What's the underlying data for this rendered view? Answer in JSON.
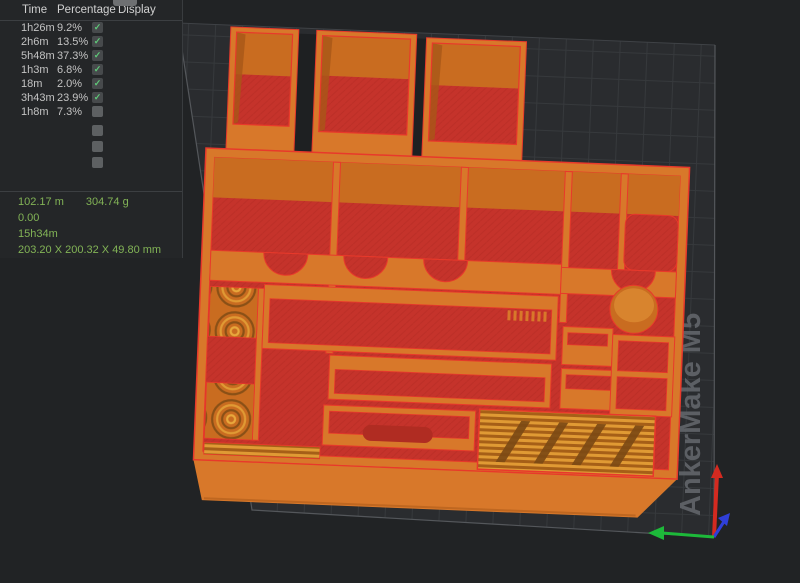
{
  "legend": {
    "headers": {
      "time": "Time",
      "percentage": "Percentage",
      "display": "Display"
    },
    "check_glyph": "✓",
    "rows": [
      {
        "time": "1h26m",
        "percentage": "9.2%",
        "checked": true
      },
      {
        "time": "2h6m",
        "percentage": "13.5%",
        "checked": true
      },
      {
        "time": "5h48m",
        "percentage": "37.3%",
        "checked": true
      },
      {
        "time": "1h3m",
        "percentage": "6.8%",
        "checked": true
      },
      {
        "time": "18m",
        "percentage": "2.0%",
        "checked": true
      },
      {
        "time": "3h43m",
        "percentage": "23.9%",
        "checked": true
      },
      {
        "time": "1h8m",
        "percentage": "7.3%",
        "checked": false
      },
      {
        "time": "",
        "percentage": "",
        "checked": false
      },
      {
        "time": "",
        "percentage": "",
        "checked": false
      },
      {
        "time": "",
        "percentage": "",
        "checked": false
      }
    ]
  },
  "stats": {
    "filament_length": "102.17 m",
    "filament_weight": "304.74 g",
    "cost": "0.00",
    "print_time": "15h34m",
    "dimensions": "203.20 X 200.32 X 49.80 mm"
  },
  "viewport": {
    "watermark": "AnkerMake M5"
  },
  "colors": {
    "accent_green": "#82b356",
    "check_green": "#5fc878",
    "model_orange": "#d8782a",
    "model_red": "#c5332b",
    "edge_red": "#e8392b",
    "plate_bg": "#2a2c2f",
    "grid_line": "#36393c",
    "axis_x": "#1db93a",
    "axis_y": "#2f3fd8",
    "axis_z": "#d42a20"
  }
}
